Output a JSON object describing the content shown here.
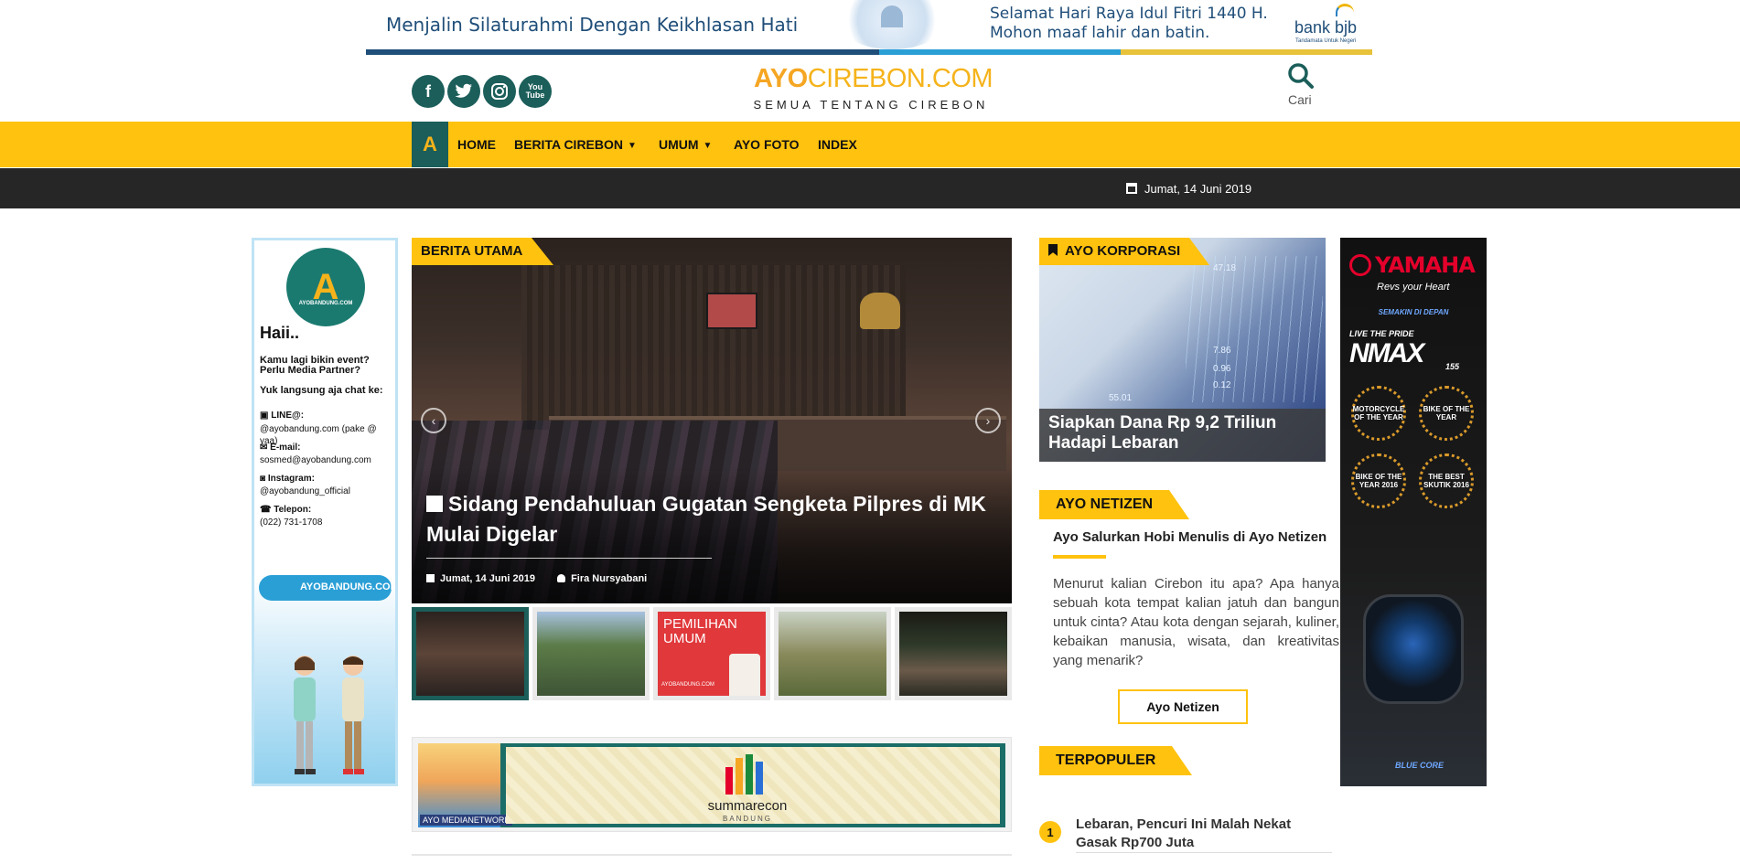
{
  "top_banner": {
    "left_text": "Menjalin Silaturahmi Dengan Keikhlasan Hati",
    "right_line1": "Selamat Hari Raya Idul Fitri 1440 H.",
    "right_line2": "Mohon maaf lahir dan batin.",
    "bank_name": "bank bjb",
    "bank_tagline": "Tandamata Untuk Negeri"
  },
  "header": {
    "social": [
      "facebook-icon",
      "twitter-icon",
      "instagram-icon",
      "youtube-icon"
    ],
    "youtube_label": "You Tube",
    "logo_ayo": "AYO",
    "logo_cirebon": "CIREBON.COM",
    "logo_sub": "SEMUA TENTANG CIREBON",
    "search_label": "Cari"
  },
  "nav": {
    "home_icon_letter": "A",
    "items": [
      {
        "label": "HOME",
        "dropdown": false
      },
      {
        "label": "BERITA CIREBON",
        "dropdown": true
      },
      {
        "label": "UMUM",
        "dropdown": true
      },
      {
        "label": "AYO FOTO",
        "dropdown": false
      },
      {
        "label": "INDEX",
        "dropdown": false
      }
    ],
    "caret": "▼"
  },
  "date_bar": {
    "date": "Jumat, 14 Juni 2019"
  },
  "left_ad": {
    "logo_letter": "A",
    "logo_text": "AYOBANDUNG.COM",
    "greeting": "Haii..",
    "line1": "Kamu lagi bikin event?",
    "line2": "Perlu Media Partner?",
    "line3": "Yuk langsung aja chat ke:",
    "line_label": "LINE@:",
    "line_value": "@ayobandung.com (pake @ yaa)",
    "email_label": "E-mail:",
    "email_value": "sosmed@ayobandung.com",
    "ig_label": "Instagram:",
    "ig_value": "@ayobandung_official",
    "phone_label": "Telepon:",
    "phone_value": "(022) 731-1708",
    "plane_text": "AYOBANDUNG.COM"
  },
  "headline": {
    "tag": "BERITA UTAMA",
    "title": "Sidang Pendahuluan Gugatan Sengketa Pilpres di MK Mulai Digelar",
    "date": "Jumat, 14 Juni 2019",
    "author": "Fira Nursyabani",
    "prev_arrow": "‹",
    "next_arrow": "›"
  },
  "thumbnails": [
    {
      "name": "thumb-courtroom",
      "active": true,
      "color": "#3a2a24"
    },
    {
      "name": "thumb-people-outdoors",
      "active": false,
      "color": "#4e6a48"
    },
    {
      "name": "thumb-pemilihan-umum",
      "active": false,
      "color": "#e0383b",
      "text": "PEMILIHAN UMUM",
      "sub": "AYOBANDUNG.COM"
    },
    {
      "name": "thumb-firefighter",
      "active": false,
      "color": "#8a8a5c"
    },
    {
      "name": "thumb-traffic",
      "active": false,
      "color": "#2f3a2a"
    }
  ],
  "bottom_ad": {
    "network": "AYO MEDIANETWORK",
    "brand": "summarecon",
    "brand_sub": "BANDUNG"
  },
  "korporasi": {
    "tag": "AYO KORPORASI",
    "caption": "Siapkan Dana Rp 9,2 Triliun Hadapi Lebaran",
    "numbers": [
      "47.18",
      "7.86",
      "0.96",
      "0.12",
      "55.01"
    ]
  },
  "netizen": {
    "tag": "AYO NETIZEN",
    "title": "Ayo Salurkan Hobi Menulis di Ayo Netizen",
    "text": "Menurut kalian Cirebon itu apa? Apa hanya sebuah kota tempat kalian jatuh dan bangun untuk cinta? Atau kota dengan sejarah, kuliner, kebaikan manusia, wisata, dan kreativitas yang menarik?",
    "button": "Ayo Netizen"
  },
  "terpopuler": {
    "tag": "TERPOPULER",
    "items": [
      {
        "rank": "1",
        "title": "Lebaran, Pencuri Ini Malah Nekat Gasak Rp700 Juta"
      }
    ]
  },
  "right_ad": {
    "brand": "YAMAHA",
    "tagline": "Revs your Heart",
    "semakin": "SEMAKIN DI DEPAN",
    "live": "LIVE THE PRIDE",
    "model": "NMAX",
    "engine": "155",
    "awards": [
      "MOTORCYCLE OF THE YEAR",
      "BIKE OF THE YEAR",
      "BIKE OF THE YEAR 2016",
      "THE BEST SKUTIK 2016"
    ],
    "blue_core": "BLUE CORE"
  },
  "colors": {
    "accent": "#ffc20e",
    "teal": "#1b5e5a",
    "dark_bar": "#262626"
  }
}
